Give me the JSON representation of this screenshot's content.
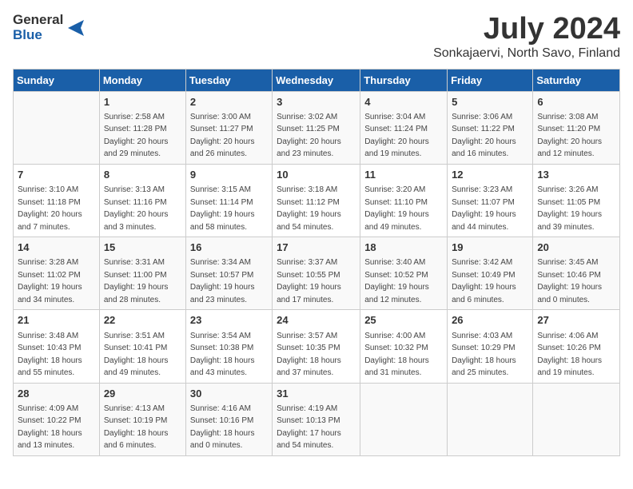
{
  "logo": {
    "general": "General",
    "blue": "Blue"
  },
  "title": "July 2024",
  "subtitle": "Sonkajaervi, North Savo, Finland",
  "columns": [
    "Sunday",
    "Monday",
    "Tuesday",
    "Wednesday",
    "Thursday",
    "Friday",
    "Saturday"
  ],
  "weeks": [
    [
      {
        "day": "",
        "info": ""
      },
      {
        "day": "1",
        "info": "Sunrise: 2:58 AM\nSunset: 11:28 PM\nDaylight: 20 hours\nand 29 minutes."
      },
      {
        "day": "2",
        "info": "Sunrise: 3:00 AM\nSunset: 11:27 PM\nDaylight: 20 hours\nand 26 minutes."
      },
      {
        "day": "3",
        "info": "Sunrise: 3:02 AM\nSunset: 11:25 PM\nDaylight: 20 hours\nand 23 minutes."
      },
      {
        "day": "4",
        "info": "Sunrise: 3:04 AM\nSunset: 11:24 PM\nDaylight: 20 hours\nand 19 minutes."
      },
      {
        "day": "5",
        "info": "Sunrise: 3:06 AM\nSunset: 11:22 PM\nDaylight: 20 hours\nand 16 minutes."
      },
      {
        "day": "6",
        "info": "Sunrise: 3:08 AM\nSunset: 11:20 PM\nDaylight: 20 hours\nand 12 minutes."
      }
    ],
    [
      {
        "day": "7",
        "info": "Sunrise: 3:10 AM\nSunset: 11:18 PM\nDaylight: 20 hours\nand 7 minutes."
      },
      {
        "day": "8",
        "info": "Sunrise: 3:13 AM\nSunset: 11:16 PM\nDaylight: 20 hours\nand 3 minutes."
      },
      {
        "day": "9",
        "info": "Sunrise: 3:15 AM\nSunset: 11:14 PM\nDaylight: 19 hours\nand 58 minutes."
      },
      {
        "day": "10",
        "info": "Sunrise: 3:18 AM\nSunset: 11:12 PM\nDaylight: 19 hours\nand 54 minutes."
      },
      {
        "day": "11",
        "info": "Sunrise: 3:20 AM\nSunset: 11:10 PM\nDaylight: 19 hours\nand 49 minutes."
      },
      {
        "day": "12",
        "info": "Sunrise: 3:23 AM\nSunset: 11:07 PM\nDaylight: 19 hours\nand 44 minutes."
      },
      {
        "day": "13",
        "info": "Sunrise: 3:26 AM\nSunset: 11:05 PM\nDaylight: 19 hours\nand 39 minutes."
      }
    ],
    [
      {
        "day": "14",
        "info": "Sunrise: 3:28 AM\nSunset: 11:02 PM\nDaylight: 19 hours\nand 34 minutes."
      },
      {
        "day": "15",
        "info": "Sunrise: 3:31 AM\nSunset: 11:00 PM\nDaylight: 19 hours\nand 28 minutes."
      },
      {
        "day": "16",
        "info": "Sunrise: 3:34 AM\nSunset: 10:57 PM\nDaylight: 19 hours\nand 23 minutes."
      },
      {
        "day": "17",
        "info": "Sunrise: 3:37 AM\nSunset: 10:55 PM\nDaylight: 19 hours\nand 17 minutes."
      },
      {
        "day": "18",
        "info": "Sunrise: 3:40 AM\nSunset: 10:52 PM\nDaylight: 19 hours\nand 12 minutes."
      },
      {
        "day": "19",
        "info": "Sunrise: 3:42 AM\nSunset: 10:49 PM\nDaylight: 19 hours\nand 6 minutes."
      },
      {
        "day": "20",
        "info": "Sunrise: 3:45 AM\nSunset: 10:46 PM\nDaylight: 19 hours\nand 0 minutes."
      }
    ],
    [
      {
        "day": "21",
        "info": "Sunrise: 3:48 AM\nSunset: 10:43 PM\nDaylight: 18 hours\nand 55 minutes."
      },
      {
        "day": "22",
        "info": "Sunrise: 3:51 AM\nSunset: 10:41 PM\nDaylight: 18 hours\nand 49 minutes."
      },
      {
        "day": "23",
        "info": "Sunrise: 3:54 AM\nSunset: 10:38 PM\nDaylight: 18 hours\nand 43 minutes."
      },
      {
        "day": "24",
        "info": "Sunrise: 3:57 AM\nSunset: 10:35 PM\nDaylight: 18 hours\nand 37 minutes."
      },
      {
        "day": "25",
        "info": "Sunrise: 4:00 AM\nSunset: 10:32 PM\nDaylight: 18 hours\nand 31 minutes."
      },
      {
        "day": "26",
        "info": "Sunrise: 4:03 AM\nSunset: 10:29 PM\nDaylight: 18 hours\nand 25 minutes."
      },
      {
        "day": "27",
        "info": "Sunrise: 4:06 AM\nSunset: 10:26 PM\nDaylight: 18 hours\nand 19 minutes."
      }
    ],
    [
      {
        "day": "28",
        "info": "Sunrise: 4:09 AM\nSunset: 10:22 PM\nDaylight: 18 hours\nand 13 minutes."
      },
      {
        "day": "29",
        "info": "Sunrise: 4:13 AM\nSunset: 10:19 PM\nDaylight: 18 hours\nand 6 minutes."
      },
      {
        "day": "30",
        "info": "Sunrise: 4:16 AM\nSunset: 10:16 PM\nDaylight: 18 hours\nand 0 minutes."
      },
      {
        "day": "31",
        "info": "Sunrise: 4:19 AM\nSunset: 10:13 PM\nDaylight: 17 hours\nand 54 minutes."
      },
      {
        "day": "",
        "info": ""
      },
      {
        "day": "",
        "info": ""
      },
      {
        "day": "",
        "info": ""
      }
    ]
  ]
}
